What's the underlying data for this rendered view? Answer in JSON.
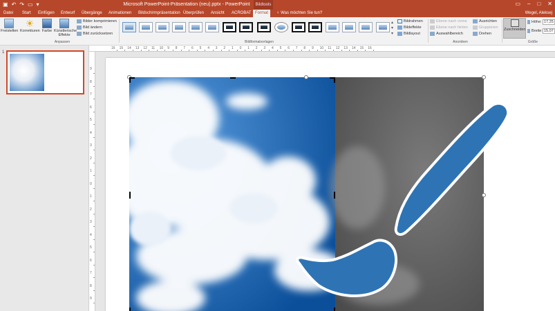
{
  "titlebar": {
    "title": "Microsoft PowerPoint-Präsentation (neu).pptx  -  PowerPoint",
    "context": "Bildtools",
    "qat": [
      "save-icon",
      "undo-icon",
      "redo-icon",
      "start-icon",
      "customize-icon"
    ]
  },
  "tabs": [
    {
      "label": "Datei"
    },
    {
      "label": "Start"
    },
    {
      "label": "Einfügen"
    },
    {
      "label": "Entwurf"
    },
    {
      "label": "Übergänge"
    },
    {
      "label": "Animationen"
    },
    {
      "label": "Bildschirmpräsentation"
    },
    {
      "label": "Überprüfen"
    },
    {
      "label": "Ansicht"
    },
    {
      "label": "ACROBAT"
    },
    {
      "label": "Format"
    }
  ],
  "tellme": "Was möchten Sie tun?",
  "user": "Wegel, Aleksej",
  "ribbon": {
    "freistellen": "Freistellen",
    "korrekturen": "Korrekturen",
    "farbe": "Farbe",
    "kuenstlerisch": "Künstlerische Effekte",
    "bilder_komprimieren": "Bilder komprimieren",
    "bild_aendern": "Bild ändern",
    "bild_zuruecksetzen": "Bild zurücksetzen",
    "group_anpassen": "Anpassen",
    "group_formatvorlagen": "Bildformatvorlagen",
    "bildrahmen": "Bildrahmen",
    "bildeffekte": "Bildeffekte",
    "bildlayout": "Bildlayout",
    "ebene_vorne": "Ebene nach vorne",
    "ebene_hinten": "Ebene nach hinten",
    "auswahlbereich": "Auswahlbereich",
    "ausrichten": "Ausrichten",
    "gruppieren": "Gruppieren",
    "drehen": "Drehen",
    "group_anordnen": "Anordnen",
    "zuschneiden": "Zuschneiden",
    "hoehe_label": "Höhe:",
    "hoehe_value": "17,25",
    "breite_label": "Breite:",
    "breite_value": "15,07",
    "group_groesse": "Größe"
  },
  "slide_panel": {
    "number": "1"
  },
  "ruler": {
    "h": [
      "16",
      "15",
      "14",
      "13",
      "12",
      "11",
      "10",
      "9",
      "8",
      "7",
      "6",
      "5",
      "4",
      "3",
      "2",
      "1",
      "0",
      "1",
      "2",
      "3",
      "4",
      "5",
      "6",
      "7",
      "8",
      "9",
      "10",
      "11",
      "12",
      "13",
      "14",
      "15",
      "16"
    ],
    "v": [
      "9",
      "8",
      "7",
      "6",
      "5",
      "4",
      "3",
      "2",
      "1",
      "0",
      "1",
      "2",
      "3",
      "4",
      "5",
      "6",
      "7",
      "8",
      "9"
    ]
  },
  "colors": {
    "accent": "#b7472a",
    "brush": "#2e74b5",
    "selection": "#d24726"
  }
}
